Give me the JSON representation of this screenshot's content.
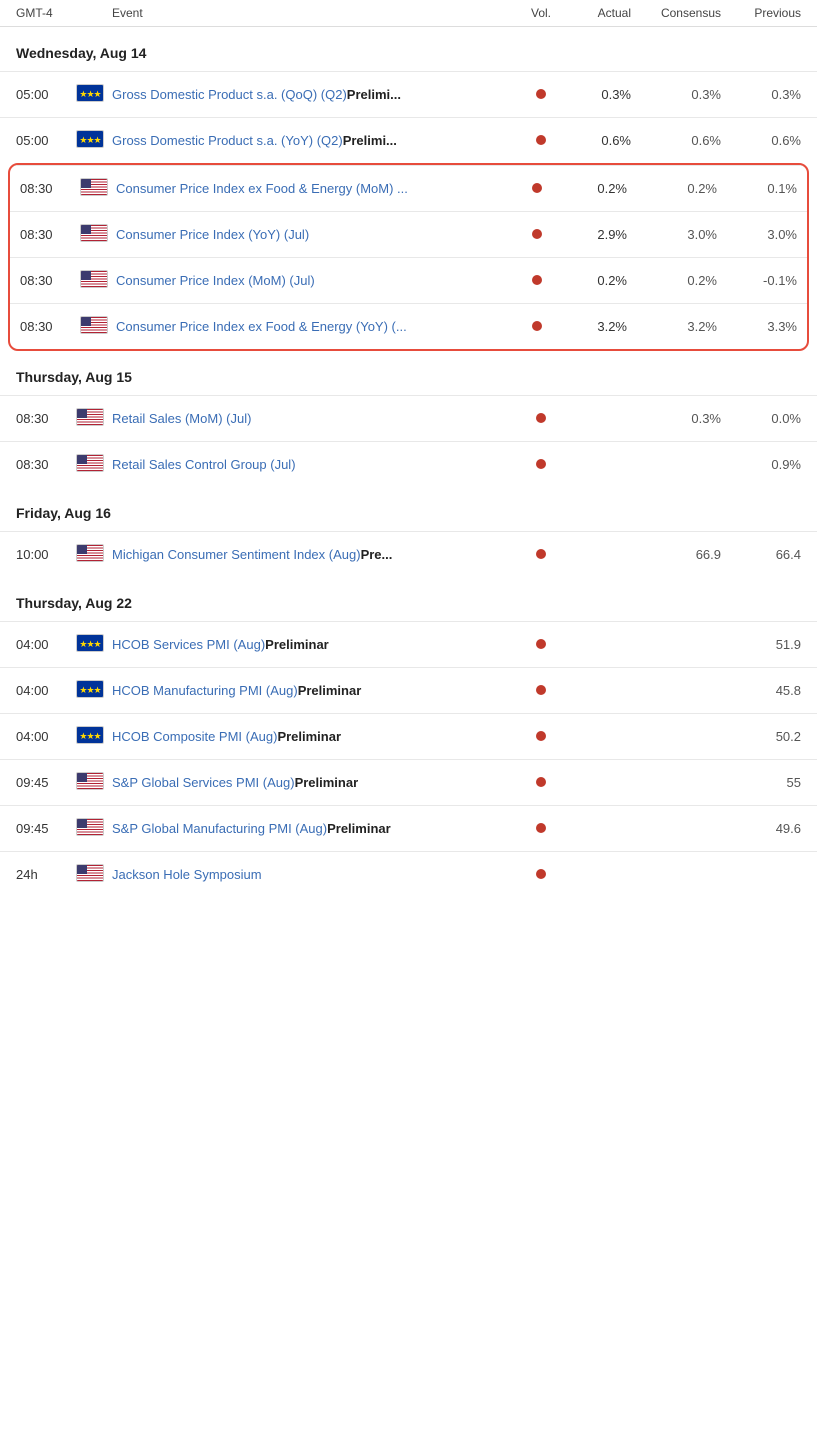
{
  "header": {
    "timezone": "GMT-4",
    "event": "Event",
    "vol": "Vol.",
    "actual": "Actual",
    "consensus": "Consensus",
    "previous": "Previous"
  },
  "days": [
    {
      "label": "Wednesday, Aug 14",
      "events": [
        {
          "time": "05:00",
          "flag": "eu",
          "name": "Gross Domestic Product s.a. (QoQ) (Q2)",
          "nameBold": "Prelimi...",
          "hasDot": true,
          "actual": "0.3%",
          "consensus": "0.3%",
          "previous": "0.3%",
          "highlighted": false
        },
        {
          "time": "05:00",
          "flag": "eu",
          "name": "Gross Domestic Product s.a. (YoY) (Q2)",
          "nameBold": "Prelimi...",
          "hasDot": true,
          "actual": "0.6%",
          "consensus": "0.6%",
          "previous": "0.6%",
          "highlighted": false
        }
      ],
      "highlightedEvents": [
        {
          "time": "08:30",
          "flag": "us",
          "name": "Consumer Price Index ex Food & Energy (MoM) ...",
          "nameBold": "",
          "hasDot": true,
          "actual": "0.2%",
          "consensus": "0.2%",
          "previous": "0.1%"
        },
        {
          "time": "08:30",
          "flag": "us",
          "name": "Consumer Price Index (YoY) (Jul)",
          "nameBold": "",
          "hasDot": true,
          "actual": "2.9%",
          "consensus": "3.0%",
          "previous": "3.0%"
        },
        {
          "time": "08:30",
          "flag": "us",
          "name": "Consumer Price Index (MoM) (Jul)",
          "nameBold": "",
          "hasDot": true,
          "actual": "0.2%",
          "consensus": "0.2%",
          "previous": "-0.1%"
        },
        {
          "time": "08:30",
          "flag": "us",
          "name": "Consumer Price Index ex Food & Energy (YoY) (...",
          "nameBold": "",
          "hasDot": true,
          "actual": "3.2%",
          "consensus": "3.2%",
          "previous": "3.3%"
        }
      ]
    },
    {
      "label": "Thursday, Aug 15",
      "events": [
        {
          "time": "08:30",
          "flag": "us",
          "name": "Retail Sales (MoM) (Jul)",
          "nameBold": "",
          "hasDot": true,
          "actual": "",
          "consensus": "0.3%",
          "previous": "0.0%",
          "highlighted": false
        },
        {
          "time": "08:30",
          "flag": "us",
          "name": "Retail Sales Control Group (Jul)",
          "nameBold": "",
          "hasDot": true,
          "actual": "",
          "consensus": "",
          "previous": "0.9%",
          "highlighted": false
        }
      ],
      "highlightedEvents": []
    },
    {
      "label": "Friday, Aug 16",
      "events": [
        {
          "time": "10:00",
          "flag": "us",
          "name": "Michigan Consumer Sentiment Index (Aug)",
          "nameBold": "Pre...",
          "hasDot": true,
          "actual": "",
          "consensus": "66.9",
          "previous": "66.4",
          "highlighted": false
        }
      ],
      "highlightedEvents": []
    },
    {
      "label": "Thursday, Aug 22",
      "events": [
        {
          "time": "04:00",
          "flag": "eu",
          "name": "HCOB Services PMI (Aug)",
          "nameBold": "Preliminar",
          "hasDot": true,
          "actual": "",
          "consensus": "",
          "previous": "51.9",
          "highlighted": false
        },
        {
          "time": "04:00",
          "flag": "eu",
          "name": "HCOB Manufacturing PMI (Aug)",
          "nameBold": "Preliminar",
          "hasDot": true,
          "actual": "",
          "consensus": "",
          "previous": "45.8",
          "highlighted": false
        },
        {
          "time": "04:00",
          "flag": "eu",
          "name": "HCOB Composite PMI (Aug)",
          "nameBold": "Preliminar",
          "hasDot": true,
          "actual": "",
          "consensus": "",
          "previous": "50.2",
          "highlighted": false
        },
        {
          "time": "09:45",
          "flag": "us",
          "name": "S&P Global Services PMI (Aug)",
          "nameBold": "Preliminar",
          "hasDot": true,
          "actual": "",
          "consensus": "",
          "previous": "55",
          "highlighted": false
        },
        {
          "time": "09:45",
          "flag": "us",
          "name": "S&P Global Manufacturing PMI (Aug)",
          "nameBold": "Preliminar",
          "hasDot": true,
          "actual": "",
          "consensus": "",
          "previous": "49.6",
          "highlighted": false
        },
        {
          "time": "24h",
          "flag": "us",
          "name": "Jackson Hole Symposium",
          "nameBold": "",
          "hasDot": true,
          "actual": "",
          "consensus": "",
          "previous": "",
          "highlighted": false
        }
      ],
      "highlightedEvents": []
    }
  ]
}
